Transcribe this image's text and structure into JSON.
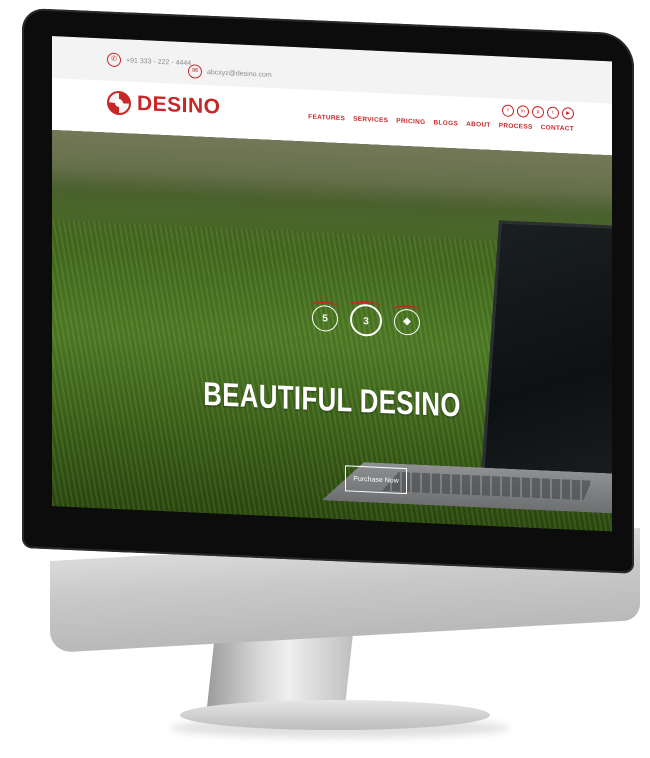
{
  "topbar": {
    "phone": "+91 333 - 222 - 4444",
    "email": "abcxyz@desino.com"
  },
  "brand": {
    "name": "DESINO",
    "accent": "#c62828"
  },
  "social_icons": [
    "facebook-icon",
    "linkedin-icon",
    "pinterest-icon",
    "twitter-icon",
    "youtube-icon"
  ],
  "nav": {
    "items": [
      "FEATURES",
      "SERVICES",
      "PRICING",
      "BLOGS",
      "ABOUT",
      "PROCESS",
      "CONTACT"
    ]
  },
  "hero": {
    "icons": [
      "html5-icon",
      "css3-icon",
      "dropbox-icon"
    ],
    "headline": "BEAUTIFUL DESINO",
    "cta": "Purchase Now"
  }
}
